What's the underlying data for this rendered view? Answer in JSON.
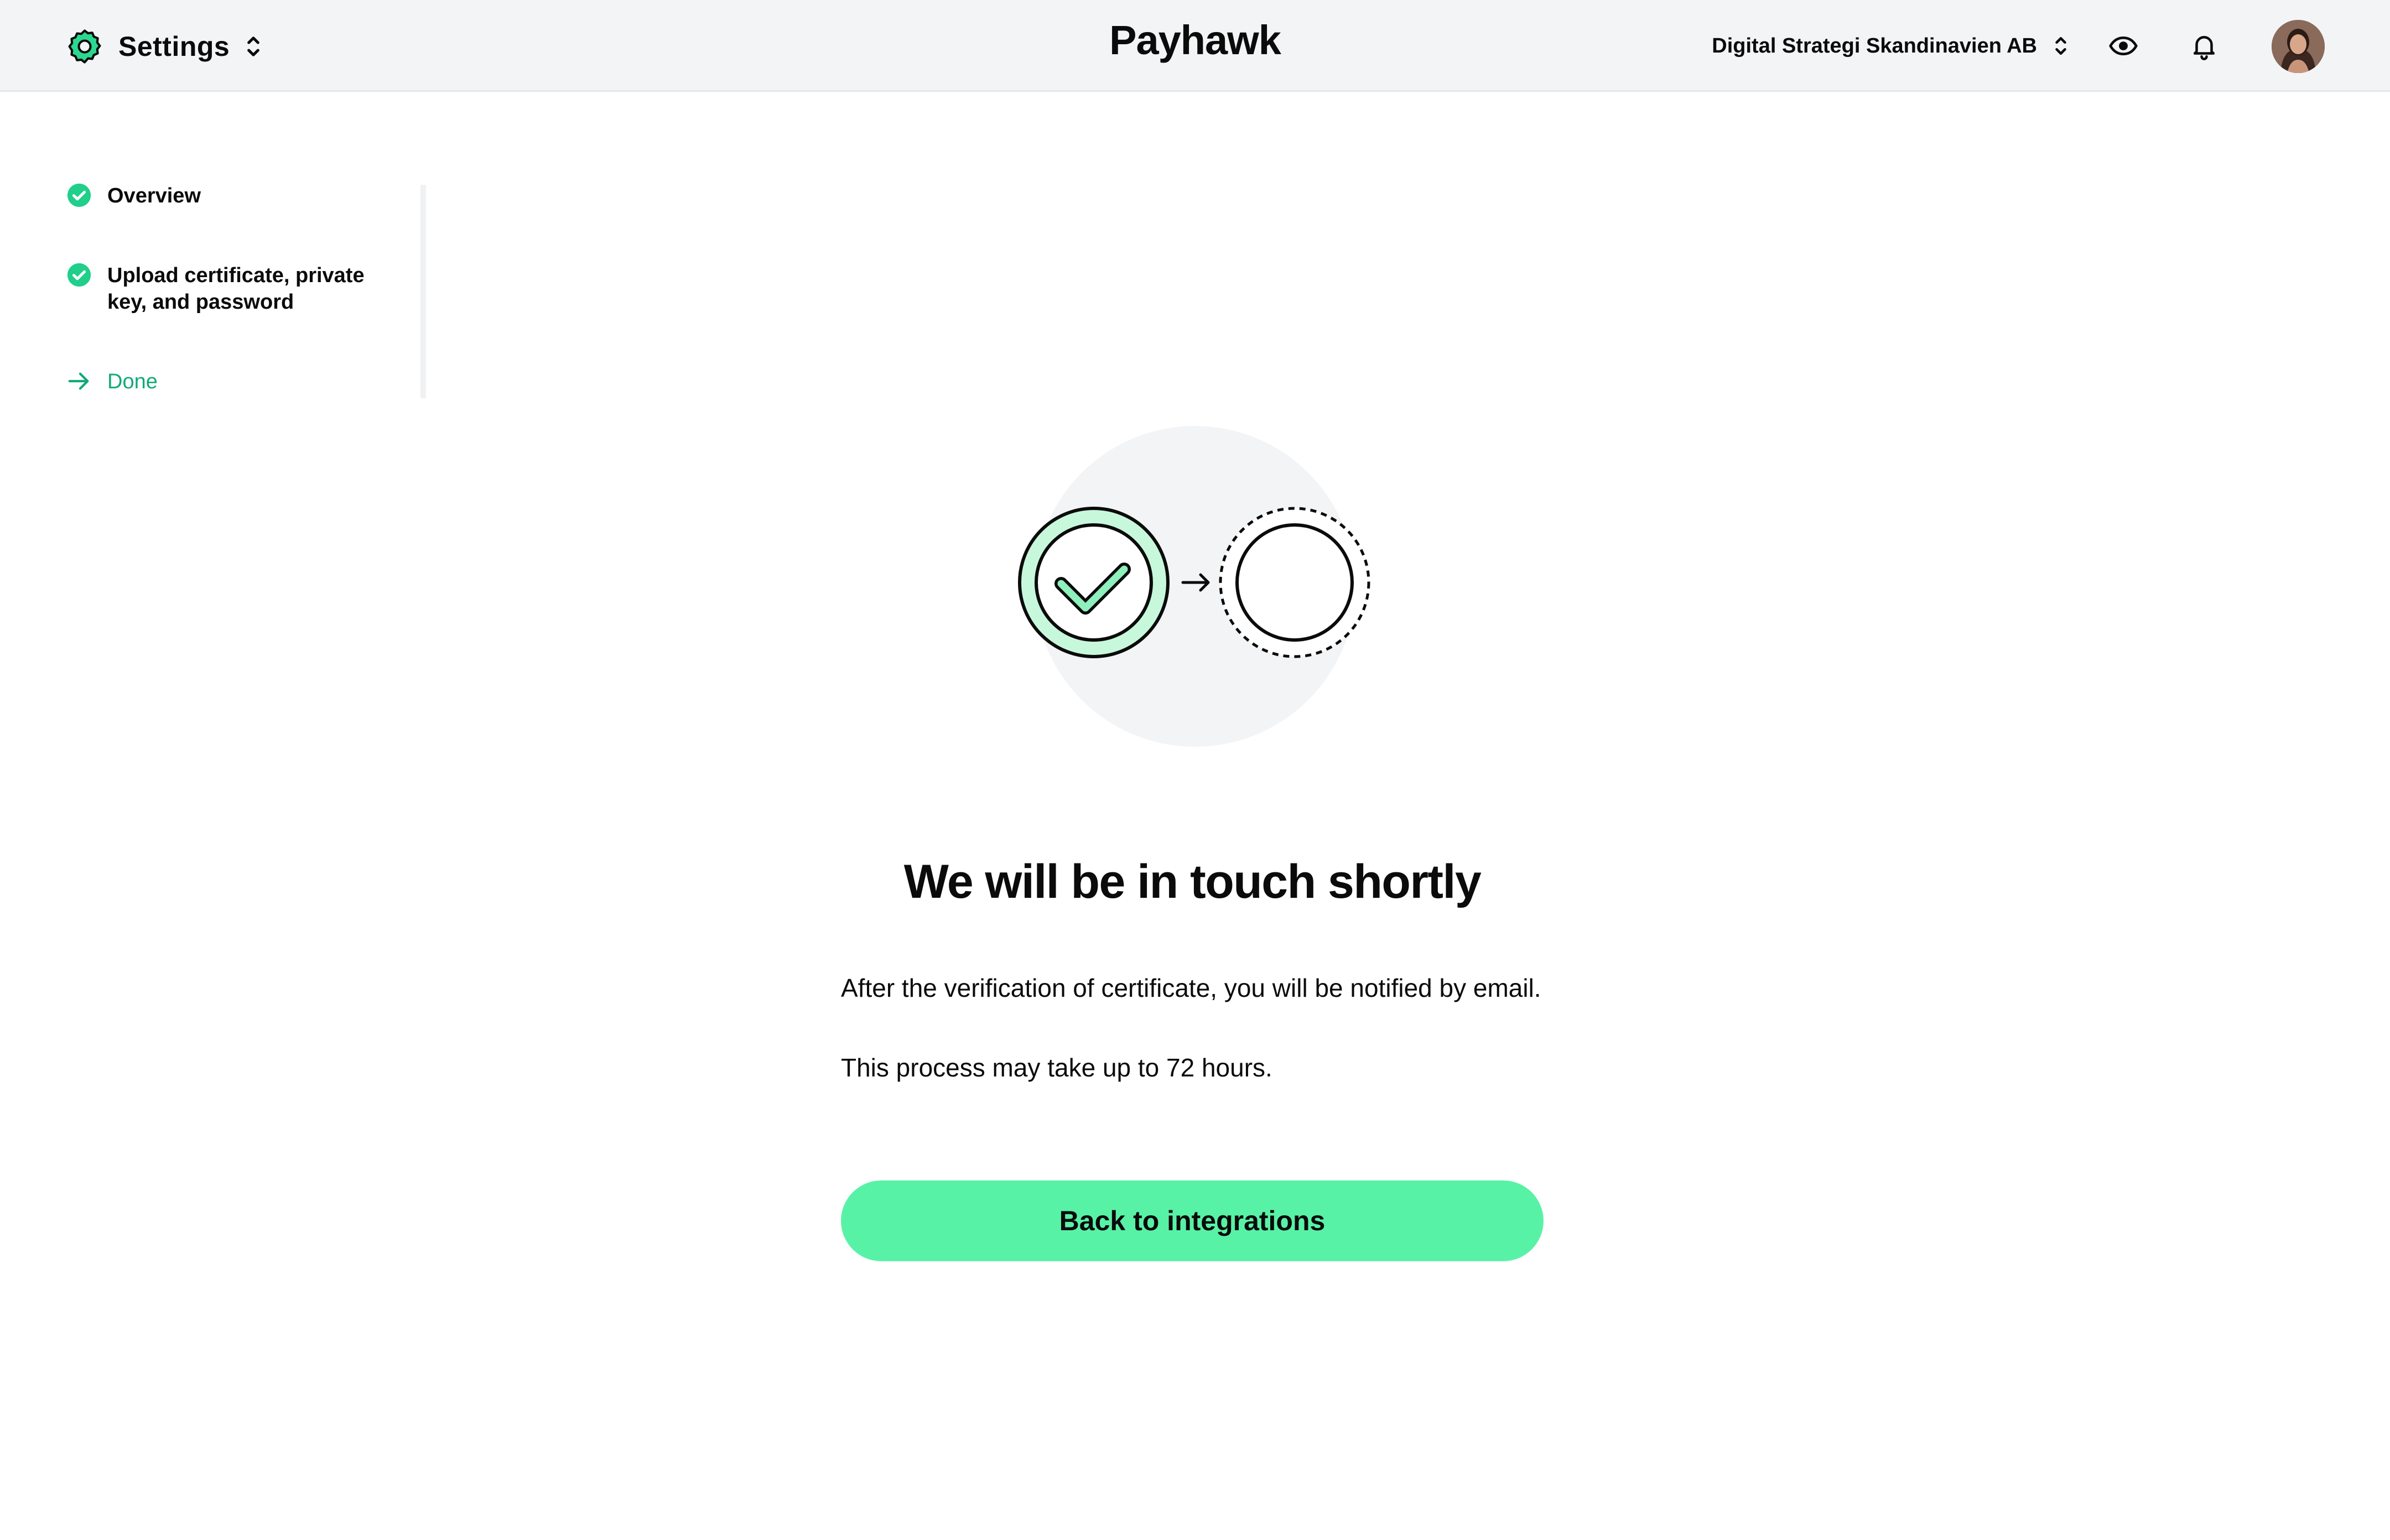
{
  "header": {
    "section_label": "Settings",
    "brand": "Payhawk",
    "company_name": "Digital Strategi Skandinavien AB",
    "icons": [
      "gear-icon",
      "updown-chevron-icon",
      "eye-icon",
      "bell-icon",
      "avatar"
    ]
  },
  "stepper": {
    "steps": [
      {
        "label": "Overview",
        "status": "completed"
      },
      {
        "label": "Upload certificate, private key, and password",
        "status": "completed"
      },
      {
        "label": "Done",
        "status": "current"
      }
    ]
  },
  "main": {
    "title": "We will be in touch shortly",
    "paragraphs": [
      "After the verification of certificate, you will be notified by email.",
      "This process may take up to 72 hours."
    ],
    "cta_label": "Back to integrations"
  },
  "colors": {
    "accent": "#58f2a6",
    "accent_text": "#11a97a",
    "check_green": "#1fcf8a",
    "header_bg": "#f3f4f6"
  }
}
